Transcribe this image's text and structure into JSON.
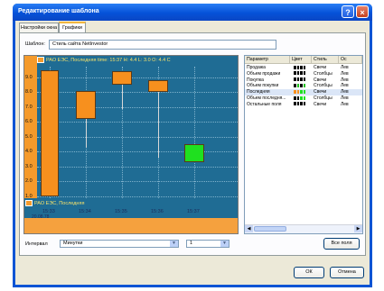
{
  "window": {
    "title": "Редактирование шаблона",
    "help_glyph": "?",
    "close_glyph": "×"
  },
  "tabs": [
    {
      "label": "Настройки окна",
      "active": false
    },
    {
      "label": "Графики",
      "active": true
    }
  ],
  "template": {
    "label": "Шаблон:",
    "value": "Стиль сайта NetInvestor"
  },
  "chart": {
    "header_main": "РАО ЕЭС, Последняя time: 15:37 H: 4.4 L: 3.0 O: 4.4 C",
    "header_lower": "РАО ЕЭС, Последняя",
    "y_ticks": [
      "9.0",
      "8.0",
      "7.0",
      "6.0",
      "5.0",
      "4.0",
      "3.0",
      "2.0",
      "1.0"
    ],
    "x_ticks": [
      "15:33",
      "15:34",
      "15:35",
      "15:36",
      "15:37"
    ],
    "x_subtitle": "20.08.78"
  },
  "chart_data": {
    "type": "candlestick",
    "categories": [
      "15:33",
      "15:34",
      "15:35",
      "15:36",
      "15:37"
    ],
    "candles": [
      {
        "x": "15:33",
        "open": 1.0,
        "close": 9.5,
        "high": 9.5,
        "low": 1.0,
        "color": "#f7901e"
      },
      {
        "x": "15:34",
        "open": 8.1,
        "close": 6.2,
        "high": 8.1,
        "low": 4.3,
        "color": "#f7901e"
      },
      {
        "x": "15:35",
        "open": 9.4,
        "close": 8.5,
        "high": 9.4,
        "low": 6.9,
        "color": "#f7901e"
      },
      {
        "x": "15:36",
        "open": 8.8,
        "close": 8.0,
        "high": 8.8,
        "low": 3.6,
        "color": "#f7901e"
      },
      {
        "x": "15:37",
        "open": 3.3,
        "close": 4.5,
        "high": 4.5,
        "low": 3.3,
        "color": "#1fe01f"
      }
    ],
    "ylim": [
      1.0,
      9.6
    ]
  },
  "params": {
    "columns": [
      "Параметр",
      "Цвет",
      "Стиль",
      "Ос"
    ],
    "rows": [
      {
        "name": "Продажа",
        "colors": [
          "#000",
          "#000",
          "#000",
          "#000"
        ],
        "style": "Свечи",
        "axis": "Лев"
      },
      {
        "name": "Объем продажи",
        "colors": [
          "#000",
          "#000",
          "#000",
          "#000"
        ],
        "style": "Столбцы",
        "axis": "Лев"
      },
      {
        "name": "Покупка",
        "colors": [
          "#000",
          "#000",
          "#000",
          "#000"
        ],
        "style": "Свечи",
        "axis": "Лев"
      },
      {
        "name": "Объем покупки",
        "colors": [
          "#000",
          "#1fbf1f",
          "#000",
          "#1fbf1f"
        ],
        "style": "Столбцы",
        "axis": "Лев"
      },
      {
        "name": "Последняя",
        "colors": [
          "#f7901e",
          "#f7901e",
          "#1fe01f",
          "#1fe01f"
        ],
        "style": "Свечи",
        "axis": "Лев",
        "selected": true
      },
      {
        "name": "Объем последня...",
        "colors": [
          "#000",
          "#000",
          "#1fe01f",
          "#1fe01f"
        ],
        "style": "Столбцы",
        "axis": "Лев"
      },
      {
        "name": "Остальные поля",
        "colors": [
          "#000",
          "#000",
          "#000",
          "#000"
        ],
        "style": "Свечи",
        "axis": "Лев"
      }
    ]
  },
  "interval": {
    "label": "Интервал",
    "unit": "Минутки",
    "count": "1"
  },
  "buttons": {
    "all_fields": "Все поля",
    "ok": "ОК",
    "cancel": "Отмена"
  }
}
